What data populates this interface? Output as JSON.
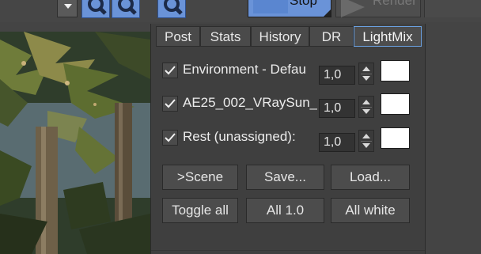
{
  "toolbar": {
    "stop_label": "Stop",
    "render_label": "Render",
    "zoom_buttons": [
      "zoom-in-icon",
      "zoom-out-icon",
      "zoom-region-icon"
    ],
    "accent_color": "#6a93d8"
  },
  "tabs": [
    {
      "label": "Post",
      "active": false
    },
    {
      "label": "Stats",
      "active": false
    },
    {
      "label": "History",
      "active": false
    },
    {
      "label": "DR",
      "active": false
    },
    {
      "label": "LightMix",
      "active": true
    }
  ],
  "lightmix": {
    "rows": [
      {
        "name": "Environment - Defau",
        "checked": true,
        "value": "1,0",
        "color": "#ffffff"
      },
      {
        "name": "AE25_002_VRaySun_",
        "checked": true,
        "value": "1,0",
        "color": "#ffffff"
      },
      {
        "name": "Rest (unassigned):",
        "checked": true,
        "value": "1,0",
        "color": "#ffffff"
      }
    ],
    "buttons_row1": [
      ">Scene",
      "Save...",
      "Load..."
    ],
    "buttons_row2": [
      "Toggle all",
      "All 1.0",
      "All white"
    ]
  }
}
